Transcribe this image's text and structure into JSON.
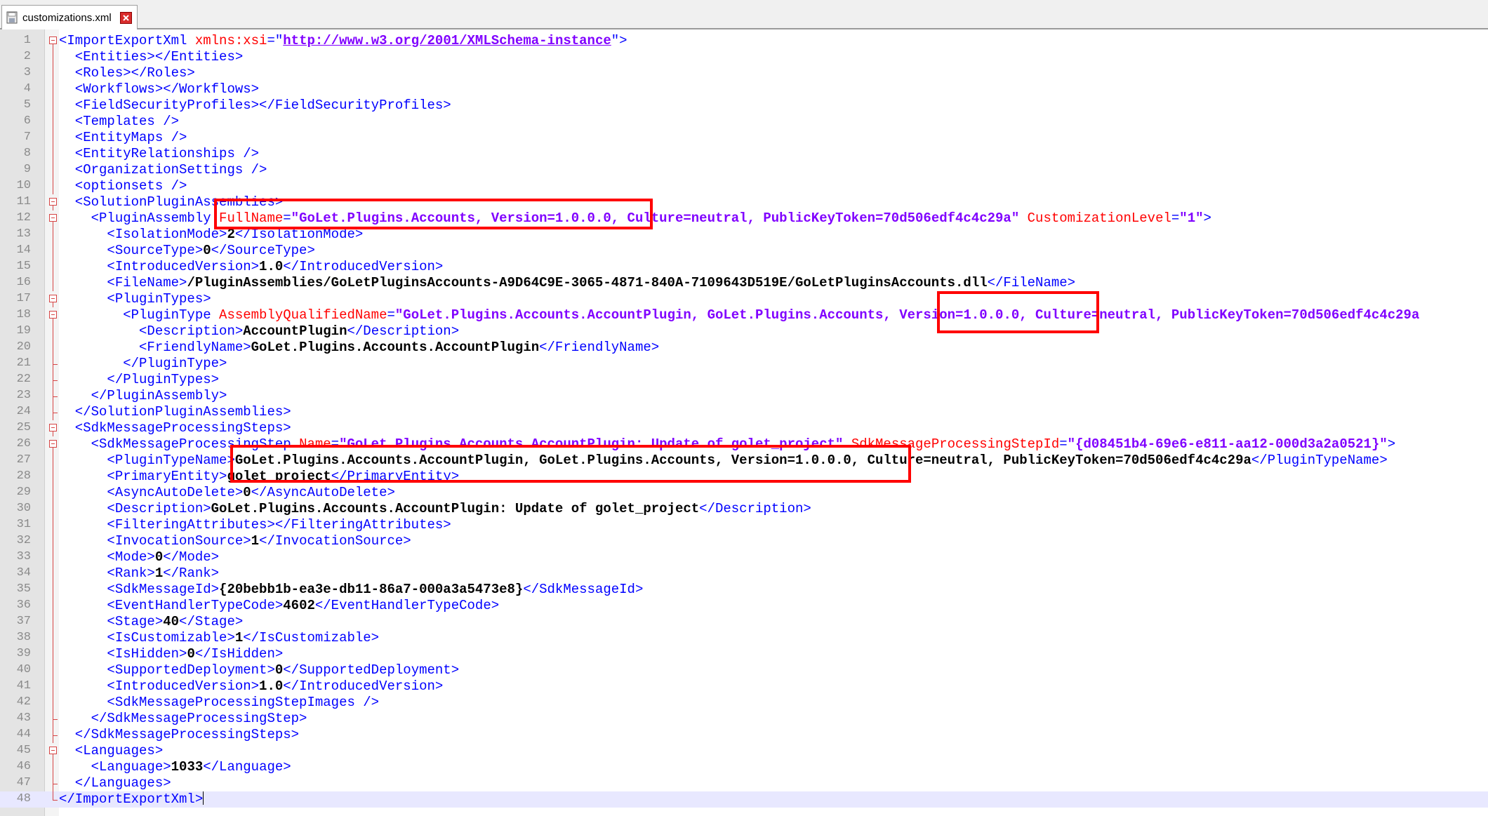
{
  "tab": {
    "title": "customizations.xml",
    "icon": "save-file-icon",
    "close_icon": "close-tab-icon"
  },
  "colors": {
    "tag": "#0000ff",
    "attribute": "#ff0000",
    "value": "#8000ff",
    "text": "#000000",
    "highlight_box": "#ff0000",
    "current_line": "#e8e8ff"
  },
  "editor": {
    "current_line": 48,
    "lines": [
      {
        "n": "1",
        "segs": [
          [
            "t",
            "<ImportExportXml "
          ],
          [
            "a",
            "xmlns:xsi"
          ],
          [
            "t",
            "=\""
          ],
          [
            "u",
            "http://www.w3.org/2001/XMLSchema-instance"
          ],
          [
            "t",
            "\">"
          ]
        ]
      },
      {
        "n": "2",
        "segs": [
          [
            "t",
            "  <Entities></Entities>"
          ]
        ]
      },
      {
        "n": "3",
        "segs": [
          [
            "t",
            "  <Roles></Roles>"
          ]
        ]
      },
      {
        "n": "4",
        "segs": [
          [
            "t",
            "  <Workflows></Workflows>"
          ]
        ]
      },
      {
        "n": "5",
        "segs": [
          [
            "t",
            "  <FieldSecurityProfiles></FieldSecurityProfiles>"
          ]
        ]
      },
      {
        "n": "6",
        "segs": [
          [
            "t",
            "  <Templates />"
          ]
        ]
      },
      {
        "n": "7",
        "segs": [
          [
            "t",
            "  <EntityMaps />"
          ]
        ]
      },
      {
        "n": "8",
        "segs": [
          [
            "t",
            "  <EntityRelationships />"
          ]
        ]
      },
      {
        "n": "9",
        "segs": [
          [
            "t",
            "  <OrganizationSettings />"
          ]
        ]
      },
      {
        "n": "10",
        "segs": [
          [
            "t",
            "  <optionsets />"
          ]
        ]
      },
      {
        "n": "11",
        "segs": [
          [
            "t",
            "  <SolutionPluginAssemblies>"
          ]
        ]
      },
      {
        "n": "12",
        "segs": [
          [
            "t",
            "    <PluginAssembly "
          ],
          [
            "a",
            "FullName"
          ],
          [
            "t",
            "="
          ],
          [
            "v",
            "\"GoLet.Plugins.Accounts, Version=1.0.0.0, Culture=neutral, PublicKeyToken=70d506edf4c4c29a\""
          ],
          [
            "t",
            " "
          ],
          [
            "a",
            "CustomizationLevel"
          ],
          [
            "t",
            "="
          ],
          [
            "v",
            "\"1\""
          ],
          [
            "t",
            ">"
          ]
        ]
      },
      {
        "n": "13",
        "segs": [
          [
            "t",
            "      <IsolationMode>"
          ],
          [
            "x",
            "2"
          ],
          [
            "t",
            "</IsolationMode>"
          ]
        ]
      },
      {
        "n": "14",
        "segs": [
          [
            "t",
            "      <SourceType>"
          ],
          [
            "x",
            "0"
          ],
          [
            "t",
            "</SourceType>"
          ]
        ]
      },
      {
        "n": "15",
        "segs": [
          [
            "t",
            "      <IntroducedVersion>"
          ],
          [
            "x",
            "1.0"
          ],
          [
            "t",
            "</IntroducedVersion>"
          ]
        ]
      },
      {
        "n": "16",
        "segs": [
          [
            "t",
            "      <FileName>"
          ],
          [
            "x",
            "/PluginAssemblies/GoLetPluginsAccounts-A9D64C9E-3065-4871-840A-7109643D519E/GoLetPluginsAccounts.dll"
          ],
          [
            "t",
            "</FileName>"
          ]
        ]
      },
      {
        "n": "17",
        "segs": [
          [
            "t",
            "      <PluginTypes>"
          ]
        ]
      },
      {
        "n": "18",
        "segs": [
          [
            "t",
            "        <PluginType "
          ],
          [
            "a",
            "AssemblyQualifiedName"
          ],
          [
            "t",
            "="
          ],
          [
            "v",
            "\"GoLet.Plugins.Accounts.AccountPlugin, GoLet.Plugins.Accounts, Version=1.0.0.0, Culture=neutral, PublicKeyToken=70d506edf4c4c29a"
          ]
        ]
      },
      {
        "n": "19",
        "segs": [
          [
            "t",
            "          <Description>"
          ],
          [
            "x",
            "AccountPlugin"
          ],
          [
            "t",
            "</Description>"
          ]
        ]
      },
      {
        "n": "20",
        "segs": [
          [
            "t",
            "          <FriendlyName>"
          ],
          [
            "x",
            "GoLet.Plugins.Accounts.AccountPlugin"
          ],
          [
            "t",
            "</FriendlyName>"
          ]
        ]
      },
      {
        "n": "21",
        "segs": [
          [
            "t",
            "        </PluginType>"
          ]
        ]
      },
      {
        "n": "22",
        "segs": [
          [
            "t",
            "      </PluginTypes>"
          ]
        ]
      },
      {
        "n": "23",
        "segs": [
          [
            "t",
            "    </PluginAssembly>"
          ]
        ]
      },
      {
        "n": "24",
        "segs": [
          [
            "t",
            "  </SolutionPluginAssemblies>"
          ]
        ]
      },
      {
        "n": "25",
        "segs": [
          [
            "t",
            "  <SdkMessageProcessingSteps>"
          ]
        ]
      },
      {
        "n": "26",
        "segs": [
          [
            "t",
            "    <SdkMessageProcessingStep "
          ],
          [
            "a",
            "Name"
          ],
          [
            "t",
            "="
          ],
          [
            "v",
            "\"GoLet.Plugins.Accounts.AccountPlugin: Update of golet_project\""
          ],
          [
            "t",
            " "
          ],
          [
            "a",
            "SdkMessageProcessingStepId"
          ],
          [
            "t",
            "="
          ],
          [
            "v",
            "\"{d08451b4-69e6-e811-aa12-000d3a2a0521}\""
          ],
          [
            "t",
            ">"
          ]
        ]
      },
      {
        "n": "27",
        "segs": [
          [
            "t",
            "      <PluginTypeName>"
          ],
          [
            "x",
            "GoLet.Plugins.Accounts.AccountPlugin, GoLet.Plugins.Accounts, Version=1.0.0.0, Culture=neutral, PublicKeyToken=70d506edf4c4c29a"
          ],
          [
            "t",
            "</PluginTypeName>"
          ]
        ]
      },
      {
        "n": "28",
        "segs": [
          [
            "t",
            "      <PrimaryEntity>"
          ],
          [
            "x",
            "golet_project"
          ],
          [
            "t",
            "</PrimaryEntity>"
          ]
        ]
      },
      {
        "n": "29",
        "segs": [
          [
            "t",
            "      <AsyncAutoDelete>"
          ],
          [
            "x",
            "0"
          ],
          [
            "t",
            "</AsyncAutoDelete>"
          ]
        ]
      },
      {
        "n": "30",
        "segs": [
          [
            "t",
            "      <Description>"
          ],
          [
            "x",
            "GoLet.Plugins.Accounts.AccountPlugin: Update of golet_project"
          ],
          [
            "t",
            "</Description>"
          ]
        ]
      },
      {
        "n": "31",
        "segs": [
          [
            "t",
            "      <FilteringAttributes></FilteringAttributes>"
          ]
        ]
      },
      {
        "n": "32",
        "segs": [
          [
            "t",
            "      <InvocationSource>"
          ],
          [
            "x",
            "1"
          ],
          [
            "t",
            "</InvocationSource>"
          ]
        ]
      },
      {
        "n": "33",
        "segs": [
          [
            "t",
            "      <Mode>"
          ],
          [
            "x",
            "0"
          ],
          [
            "t",
            "</Mode>"
          ]
        ]
      },
      {
        "n": "34",
        "segs": [
          [
            "t",
            "      <Rank>"
          ],
          [
            "x",
            "1"
          ],
          [
            "t",
            "</Rank>"
          ]
        ]
      },
      {
        "n": "35",
        "segs": [
          [
            "t",
            "      <SdkMessageId>"
          ],
          [
            "x",
            "{20bebb1b-ea3e-db11-86a7-000a3a5473e8}"
          ],
          [
            "t",
            "</SdkMessageId>"
          ]
        ]
      },
      {
        "n": "36",
        "segs": [
          [
            "t",
            "      <EventHandlerTypeCode>"
          ],
          [
            "x",
            "4602"
          ],
          [
            "t",
            "</EventHandlerTypeCode>"
          ]
        ]
      },
      {
        "n": "37",
        "segs": [
          [
            "t",
            "      <Stage>"
          ],
          [
            "x",
            "40"
          ],
          [
            "t",
            "</Stage>"
          ]
        ]
      },
      {
        "n": "38",
        "segs": [
          [
            "t",
            "      <IsCustomizable>"
          ],
          [
            "x",
            "1"
          ],
          [
            "t",
            "</IsCustomizable>"
          ]
        ]
      },
      {
        "n": "39",
        "segs": [
          [
            "t",
            "      <IsHidden>"
          ],
          [
            "x",
            "0"
          ],
          [
            "t",
            "</IsHidden>"
          ]
        ]
      },
      {
        "n": "40",
        "segs": [
          [
            "t",
            "      <SupportedDeployment>"
          ],
          [
            "x",
            "0"
          ],
          [
            "t",
            "</SupportedDeployment>"
          ]
        ]
      },
      {
        "n": "41",
        "segs": [
          [
            "t",
            "      <IntroducedVersion>"
          ],
          [
            "x",
            "1.0"
          ],
          [
            "t",
            "</IntroducedVersion>"
          ]
        ]
      },
      {
        "n": "42",
        "segs": [
          [
            "t",
            "      <SdkMessageProcessingStepImages />"
          ]
        ]
      },
      {
        "n": "43",
        "segs": [
          [
            "t",
            "    </SdkMessageProcessingStep>"
          ]
        ]
      },
      {
        "n": "44",
        "segs": [
          [
            "t",
            "  </SdkMessageProcessingSteps>"
          ]
        ]
      },
      {
        "n": "45",
        "segs": [
          [
            "t",
            "  <Languages>"
          ]
        ]
      },
      {
        "n": "46",
        "segs": [
          [
            "t",
            "    <Language>"
          ],
          [
            "x",
            "1033"
          ],
          [
            "t",
            "</Language>"
          ]
        ]
      },
      {
        "n": "47",
        "segs": [
          [
            "t",
            "  </Languages>"
          ]
        ]
      },
      {
        "n": "48",
        "segs": [
          [
            "t",
            "</ImportExportXml>"
          ]
        ]
      }
    ]
  }
}
